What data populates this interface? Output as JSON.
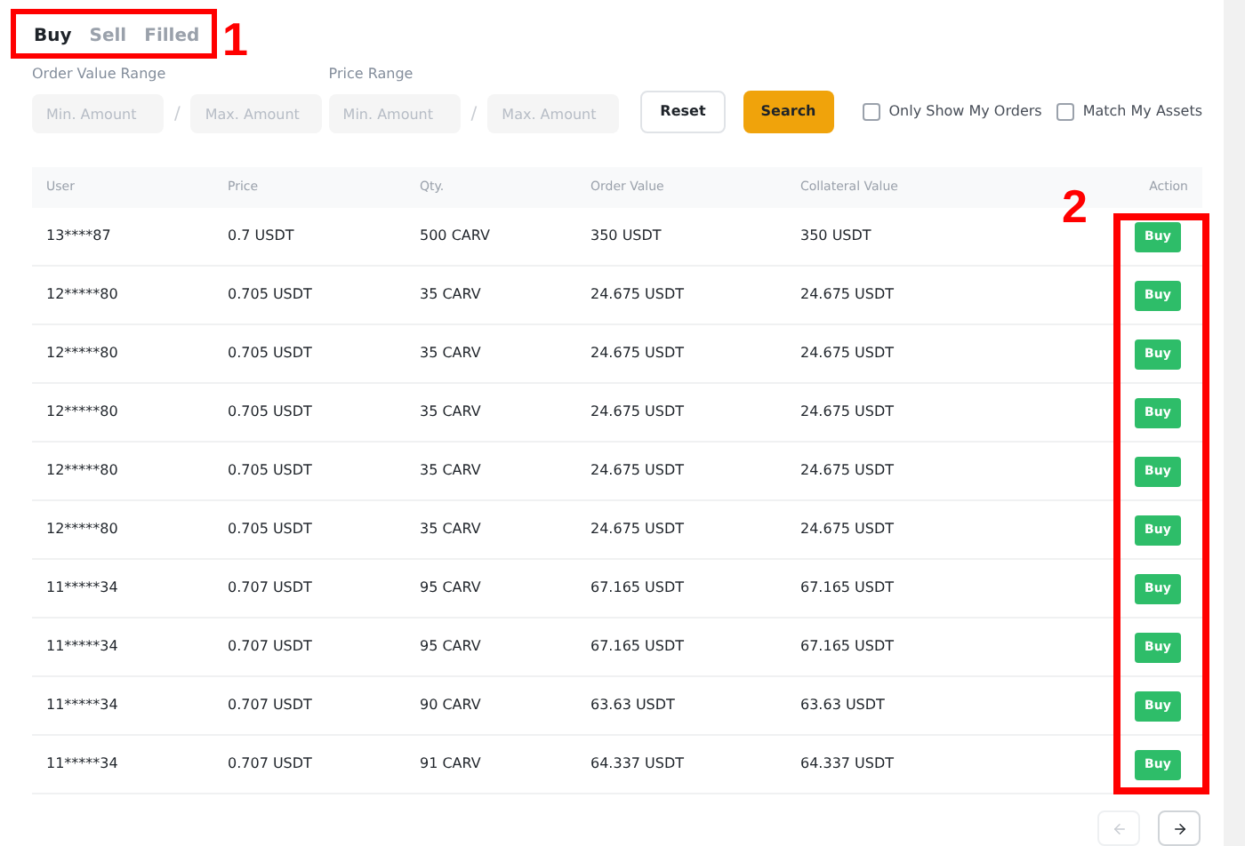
{
  "tabs": [
    {
      "label": "Buy",
      "selected": true
    },
    {
      "label": "Sell",
      "selected": false
    },
    {
      "label": "Filled",
      "selected": false
    }
  ],
  "filters": {
    "order_value_range": {
      "label": "Order Value Range",
      "min": {
        "placeholder": "Min. Amount"
      },
      "separator": "/",
      "max": {
        "placeholder": "Max. Amount"
      }
    },
    "price_range": {
      "label": "Price Range",
      "min": {
        "placeholder": "Min. Amount"
      },
      "separator": "/",
      "max": {
        "placeholder": "Max. Amount"
      }
    },
    "reset": "Reset",
    "search": "Search",
    "checkboxes": [
      {
        "label": "Only Show My Orders",
        "checked": false
      },
      {
        "label": "Match My Assets",
        "checked": false
      }
    ]
  },
  "table": {
    "columns": [
      "User",
      "Price",
      "Qty.",
      "Order Value",
      "Collateral Value",
      "Action"
    ],
    "rows": [
      {
        "user": "13****87",
        "price": "0.7 USDT",
        "qty": "500 CARV",
        "order_value": "350 USDT",
        "collateral_value": "350 USDT",
        "action": "Buy"
      },
      {
        "user": "12*****80",
        "price": "0.705 USDT",
        "qty": "35 CARV",
        "order_value": "24.675 USDT",
        "collateral_value": "24.675 USDT",
        "action": "Buy"
      },
      {
        "user": "12*****80",
        "price": "0.705 USDT",
        "qty": "35 CARV",
        "order_value": "24.675 USDT",
        "collateral_value": "24.675 USDT",
        "action": "Buy"
      },
      {
        "user": "12*****80",
        "price": "0.705 USDT",
        "qty": "35 CARV",
        "order_value": "24.675 USDT",
        "collateral_value": "24.675 USDT",
        "action": "Buy"
      },
      {
        "user": "12*****80",
        "price": "0.705 USDT",
        "qty": "35 CARV",
        "order_value": "24.675 USDT",
        "collateral_value": "24.675 USDT",
        "action": "Buy"
      },
      {
        "user": "12*****80",
        "price": "0.705 USDT",
        "qty": "35 CARV",
        "order_value": "24.675 USDT",
        "collateral_value": "24.675 USDT",
        "action": "Buy"
      },
      {
        "user": "11*****34",
        "price": "0.707 USDT",
        "qty": "95 CARV",
        "order_value": "67.165 USDT",
        "collateral_value": "67.165 USDT",
        "action": "Buy"
      },
      {
        "user": "11*****34",
        "price": "0.707 USDT",
        "qty": "95 CARV",
        "order_value": "67.165 USDT",
        "collateral_value": "67.165 USDT",
        "action": "Buy"
      },
      {
        "user": "11*****34",
        "price": "0.707 USDT",
        "qty": "90 CARV",
        "order_value": "63.63 USDT",
        "collateral_value": "63.63 USDT",
        "action": "Buy"
      },
      {
        "user": "11*****34",
        "price": "0.707 USDT",
        "qty": "91 CARV",
        "order_value": "64.337 USDT",
        "collateral_value": "64.337 USDT",
        "action": "Buy"
      }
    ]
  },
  "pagination": {
    "previous": {
      "disabled": true
    },
    "next": {
      "disabled": false
    }
  },
  "annotations": [
    {
      "label": "1"
    },
    {
      "label": "2"
    }
  ]
}
